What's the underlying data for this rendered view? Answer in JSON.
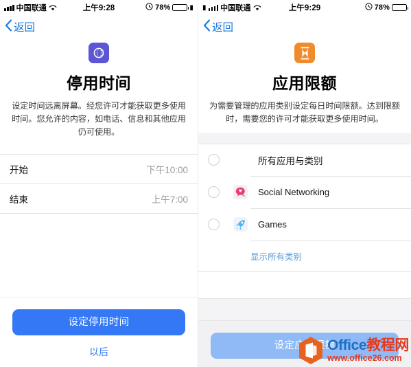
{
  "screens": [
    {
      "id": "downtime",
      "status_bar": {
        "carrier": "中国联通",
        "signal_icon": "signal-bars-icon",
        "wifi_icon": "wifi-icon",
        "time": "上午9:28",
        "alarm_icon": "alarm-icon",
        "battery_percent": "78%",
        "battery_icon": "battery-icon"
      },
      "nav": {
        "back_icon": "chevron-left-icon",
        "back_label": "返回"
      },
      "hero": {
        "icon_name": "downtime-moon-icon",
        "icon_color": "#5c56d4",
        "title": "停用时间",
        "description": "设定时间远离屏幕。经您许可才能获取更多使用时间。您允许的内容，如电话、信息和其他应用仍可使用。"
      },
      "time_rows": [
        {
          "label": "开始",
          "value": "下午10:00"
        },
        {
          "label": "结束",
          "value": "上午7:00"
        }
      ],
      "footer": {
        "primary_label": "设定停用时间",
        "primary_enabled": true,
        "primary_color": "#3478f6",
        "secondary_label": "以后",
        "secondary_color": "#3478f6"
      }
    },
    {
      "id": "app-limits",
      "status_bar": {
        "carrier": "中国联通",
        "signal_icon": "signal-bars-icon",
        "wifi_icon": "wifi-icon",
        "time": "上午9:29",
        "alarm_icon": "alarm-icon",
        "battery_percent": "78%",
        "battery_icon": "battery-icon"
      },
      "nav": {
        "back_icon": "chevron-left-icon",
        "back_label": "返回"
      },
      "hero": {
        "icon_name": "hourglass-icon",
        "icon_color": "#ef8b2c",
        "title": "应用限额",
        "description": "为需要管理的应用类别设定每日时间限额。达到限额时，需要您的许可才能获取更多使用时间。"
      },
      "categories": [
        {
          "label": "所有应用与类别",
          "icon_name": "none",
          "selected": false
        },
        {
          "label": "Social Networking",
          "icon_name": "social-networking-icon",
          "selected": false
        },
        {
          "label": "Games",
          "icon_name": "games-rocket-icon",
          "selected": false
        }
      ],
      "show_all_label": "显示所有类别",
      "show_all_color": "#5b9bd8",
      "footer": {
        "primary_label": "设定应用限额",
        "primary_enabled": false,
        "primary_color": "#8fbaf5"
      }
    }
  ],
  "watermark": {
    "logo_icon": "office-hexagon-logo-icon",
    "brand_en": "Office",
    "brand_cn": "教程网",
    "url": "www.office26.com",
    "brand_en_color": "#1c6fc4",
    "brand_cn_color": "#e8381a"
  }
}
